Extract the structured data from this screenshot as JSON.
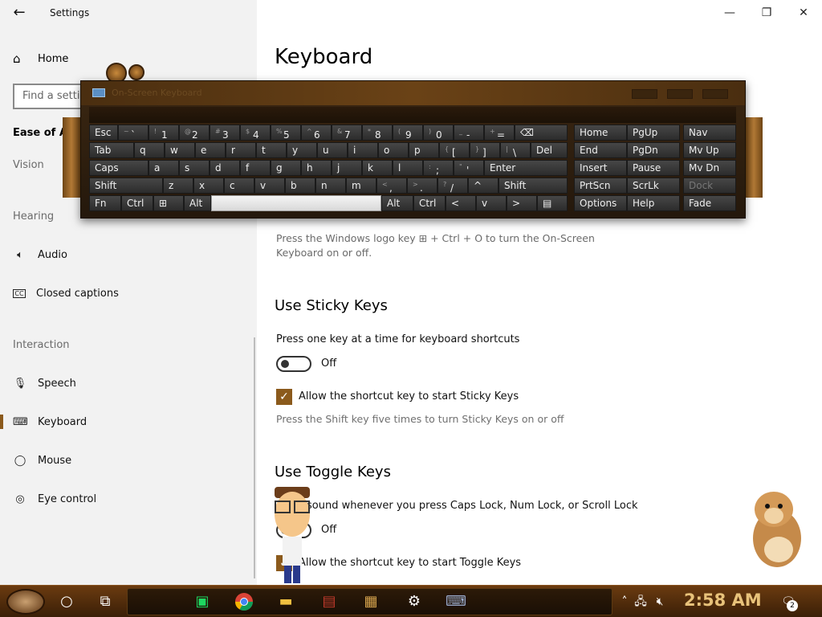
{
  "window": {
    "title": "Settings"
  },
  "sidebar": {
    "home": "Home",
    "search_placeholder": "Find a setting",
    "section": "Ease of Access",
    "groups": {
      "vision": "Vision",
      "hearing": "Hearing",
      "interaction": "Interaction"
    },
    "items": [
      {
        "label": "Audio",
        "icon": "speaker-icon"
      },
      {
        "label": "Closed captions",
        "icon": "cc-icon"
      },
      {
        "label": "Speech",
        "icon": "microphone-icon"
      },
      {
        "label": "Keyboard",
        "icon": "keyboard-icon",
        "selected": true
      },
      {
        "label": "Mouse",
        "icon": "mouse-icon"
      },
      {
        "label": "Eye control",
        "icon": "eye-control-icon"
      }
    ]
  },
  "main": {
    "title": "Keyboard",
    "osk_hint": "Press the Windows logo key ⊞ + Ctrl + O to turn the On-Screen Keyboard on or off.",
    "sticky": {
      "heading": "Use Sticky Keys",
      "desc": "Press one key at a time for keyboard shortcuts",
      "toggle_state": "Off",
      "checkbox_label": "Allow the shortcut key to start Sticky Keys",
      "checked": true,
      "hint": "Press the Shift key five times to turn Sticky Keys on or off"
    },
    "toggle_keys": {
      "heading": "Use Toggle Keys",
      "desc": "sound whenever you press Caps Lock, Num Lock, or Scroll Lock",
      "toggle_state": "Off",
      "checkbox_label": "Allow the shortcut key to start Toggle Keys",
      "checked": true
    }
  },
  "osk": {
    "title": "On-Screen Keyboard",
    "row1": [
      {
        "main": "Esc"
      },
      {
        "sub": "~",
        "main": "`"
      },
      {
        "sub": "!",
        "main": "1"
      },
      {
        "sub": "@",
        "main": "2"
      },
      {
        "sub": "#",
        "main": "3"
      },
      {
        "sub": "$",
        "main": "4"
      },
      {
        "sub": "%",
        "main": "5"
      },
      {
        "sub": "^",
        "main": "6"
      },
      {
        "sub": "&",
        "main": "7"
      },
      {
        "sub": "*",
        "main": "8"
      },
      {
        "sub": "(",
        "main": "9"
      },
      {
        "sub": ")",
        "main": "0"
      },
      {
        "sub": "_",
        "main": "-"
      },
      {
        "sub": "+",
        "main": "="
      },
      {
        "main": "⌫"
      }
    ],
    "row2": [
      {
        "main": "Tab"
      },
      {
        "main": "q"
      },
      {
        "main": "w"
      },
      {
        "main": "e"
      },
      {
        "main": "r"
      },
      {
        "main": "t"
      },
      {
        "main": "y"
      },
      {
        "main": "u"
      },
      {
        "main": "i"
      },
      {
        "main": "o"
      },
      {
        "main": "p"
      },
      {
        "sub": "{",
        "main": "["
      },
      {
        "sub": "}",
        "main": "]"
      },
      {
        "sub": "|",
        "main": "\\"
      },
      {
        "main": "Del"
      }
    ],
    "row3": [
      {
        "main": "Caps"
      },
      {
        "main": "a"
      },
      {
        "main": "s"
      },
      {
        "main": "d"
      },
      {
        "main": "f"
      },
      {
        "main": "g"
      },
      {
        "main": "h"
      },
      {
        "main": "j"
      },
      {
        "main": "k"
      },
      {
        "main": "l"
      },
      {
        "sub": ":",
        "main": ";"
      },
      {
        "sub": "\"",
        "main": "'"
      },
      {
        "main": "Enter"
      }
    ],
    "row4": [
      {
        "main": "Shift"
      },
      {
        "main": "z"
      },
      {
        "main": "x"
      },
      {
        "main": "c"
      },
      {
        "main": "v"
      },
      {
        "main": "b"
      },
      {
        "main": "n"
      },
      {
        "main": "m"
      },
      {
        "sub": "<",
        "main": ","
      },
      {
        "sub": ">",
        "main": "."
      },
      {
        "sub": "?",
        "main": "/"
      },
      {
        "main": "^"
      },
      {
        "main": "Shift"
      }
    ],
    "row5": [
      {
        "main": "Fn"
      },
      {
        "main": "Ctrl"
      },
      {
        "main": "⊞"
      },
      {
        "main": "Alt"
      },
      {
        "main": ""
      },
      {
        "main": "Alt"
      },
      {
        "main": "Ctrl"
      },
      {
        "main": "<"
      },
      {
        "main": "v"
      },
      {
        "main": ">"
      },
      {
        "main": "▤"
      }
    ],
    "nav_keys": [
      [
        "Home",
        "PgUp",
        "Nav"
      ],
      [
        "End",
        "PgDn",
        "Mv Up"
      ],
      [
        "Insert",
        "Pause",
        "Mv Dn"
      ],
      [
        "PrtScn",
        "ScrLk",
        "Dock"
      ],
      [
        "Options",
        "Help",
        "Fade"
      ]
    ]
  },
  "taskbar": {
    "time": "2:58 AM",
    "notification_count": "2",
    "pinned": [
      "spotify-icon",
      "chrome-icon",
      "file-explorer-icon",
      "app-icon",
      "game-icon",
      "settings-icon",
      "osk-icon"
    ]
  }
}
